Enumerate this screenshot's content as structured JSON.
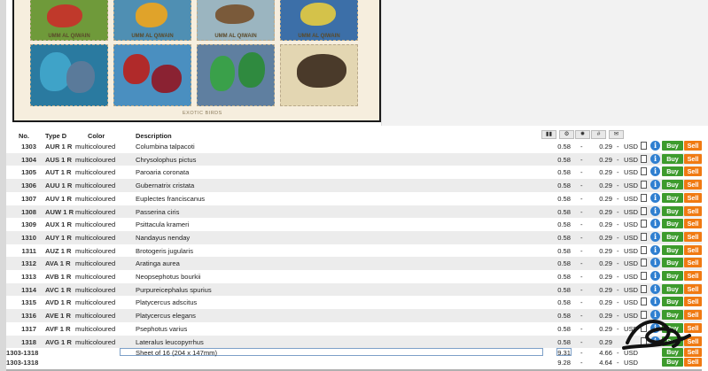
{
  "sheet_image": {
    "captions": [
      "UMM AL QIWAIN",
      "UMM AL QIWAIN",
      "UMM AL QIWAIN",
      "UMM AL QIWAIN"
    ],
    "caption": "EXOTIC BIRDS"
  },
  "table_header": {
    "no": "No.",
    "type": "Type D",
    "color": "Color",
    "description": "Description"
  },
  "rows": [
    {
      "no": "1303",
      "type": "AUR 1 R",
      "color": "multicoloured",
      "desc": "Columbina talpacoti",
      "p1": "0.58",
      "d1": "-",
      "p2": "0.29",
      "d2": "-",
      "cur": "USD"
    },
    {
      "no": "1304",
      "type": "AUS 1 R",
      "color": "multicoloured",
      "desc": "Chrysolophus pictus",
      "p1": "0.58",
      "d1": "-",
      "p2": "0.29",
      "d2": "-",
      "cur": "USD"
    },
    {
      "no": "1305",
      "type": "AUT 1 R",
      "color": "multicoloured",
      "desc": "Paroaria coronata",
      "p1": "0.58",
      "d1": "-",
      "p2": "0.29",
      "d2": "-",
      "cur": "USD"
    },
    {
      "no": "1306",
      "type": "AUU 1 R",
      "color": "multicoloured",
      "desc": "Gubernatrix cristata",
      "p1": "0.58",
      "d1": "-",
      "p2": "0.29",
      "d2": "-",
      "cur": "USD"
    },
    {
      "no": "1307",
      "type": "AUV 1 R",
      "color": "multicoloured",
      "desc": "Euplectes franciscanus",
      "p1": "0.58",
      "d1": "-",
      "p2": "0.29",
      "d2": "-",
      "cur": "USD"
    },
    {
      "no": "1308",
      "type": "AUW 1 R",
      "color": "multicoloured",
      "desc": "Passerina ciris",
      "p1": "0.58",
      "d1": "-",
      "p2": "0.29",
      "d2": "-",
      "cur": "USD"
    },
    {
      "no": "1309",
      "type": "AUX 1 R",
      "color": "multicoloured",
      "desc": "Psittacula krameri",
      "p1": "0.58",
      "d1": "-",
      "p2": "0.29",
      "d2": "-",
      "cur": "USD"
    },
    {
      "no": "1310",
      "type": "AUY 1 R",
      "color": "multicoloured",
      "desc": "Nandayus nenday",
      "p1": "0.58",
      "d1": "-",
      "p2": "0.29",
      "d2": "-",
      "cur": "USD"
    },
    {
      "no": "1311",
      "type": "AUZ 1 R",
      "color": "multicoloured",
      "desc": "Brotogeris jugularis",
      "p1": "0.58",
      "d1": "-",
      "p2": "0.29",
      "d2": "-",
      "cur": "USD"
    },
    {
      "no": "1312",
      "type": "AVA 1 R",
      "color": "multicoloured",
      "desc": "Aratinga aurea",
      "p1": "0.58",
      "d1": "-",
      "p2": "0.29",
      "d2": "-",
      "cur": "USD"
    },
    {
      "no": "1313",
      "type": "AVB 1 R",
      "color": "multicoloured",
      "desc": "Neopsephotus bourkii",
      "p1": "0.58",
      "d1": "-",
      "p2": "0.29",
      "d2": "-",
      "cur": "USD"
    },
    {
      "no": "1314",
      "type": "AVC 1 R",
      "color": "multicoloured",
      "desc": "Purpureicephalus spurius",
      "p1": "0.58",
      "d1": "-",
      "p2": "0.29",
      "d2": "-",
      "cur": "USD"
    },
    {
      "no": "1315",
      "type": "AVD 1 R",
      "color": "multicoloured",
      "desc": "Platycercus adscitus",
      "p1": "0.58",
      "d1": "-",
      "p2": "0.29",
      "d2": "-",
      "cur": "USD"
    },
    {
      "no": "1316",
      "type": "AVE 1 R",
      "color": "multicoloured",
      "desc": "Platycercus elegans",
      "p1": "0.58",
      "d1": "-",
      "p2": "0.29",
      "d2": "-",
      "cur": "USD"
    },
    {
      "no": "1317",
      "type": "AVF 1 R",
      "color": "multicoloured",
      "desc": "Psephotus varius",
      "p1": "0.58",
      "d1": "-",
      "p2": "0.29",
      "d2": "-",
      "cur": "USD"
    },
    {
      "no": "1318",
      "type": "AVG 1 R",
      "color": "multicoloured",
      "desc": "Lateralus leucopyrrhus",
      "p1": "0.58",
      "d1": "-",
      "p2": "0.29",
      "d2": "",
      "cur": ""
    }
  ],
  "sheet_rows": [
    {
      "no": "1303-1318",
      "desc": "Sheet of 16 (204 x 147mm)",
      "p1": "9.31",
      "d1": "-",
      "p2": "4.66",
      "d2": "-",
      "cur": "USD"
    },
    {
      "no": "1303-1318",
      "desc": "",
      "p1": "9.28",
      "d1": "-",
      "p2": "4.64",
      "d2": "-",
      "cur": "USD"
    }
  ],
  "buttons": {
    "buy": "Buy",
    "sell": "Sell",
    "info": "i"
  },
  "colors": {
    "buy": "#3d9b2d",
    "sell": "#f07a12",
    "info": "#2f7fd0",
    "row_alt": "#ececec"
  }
}
